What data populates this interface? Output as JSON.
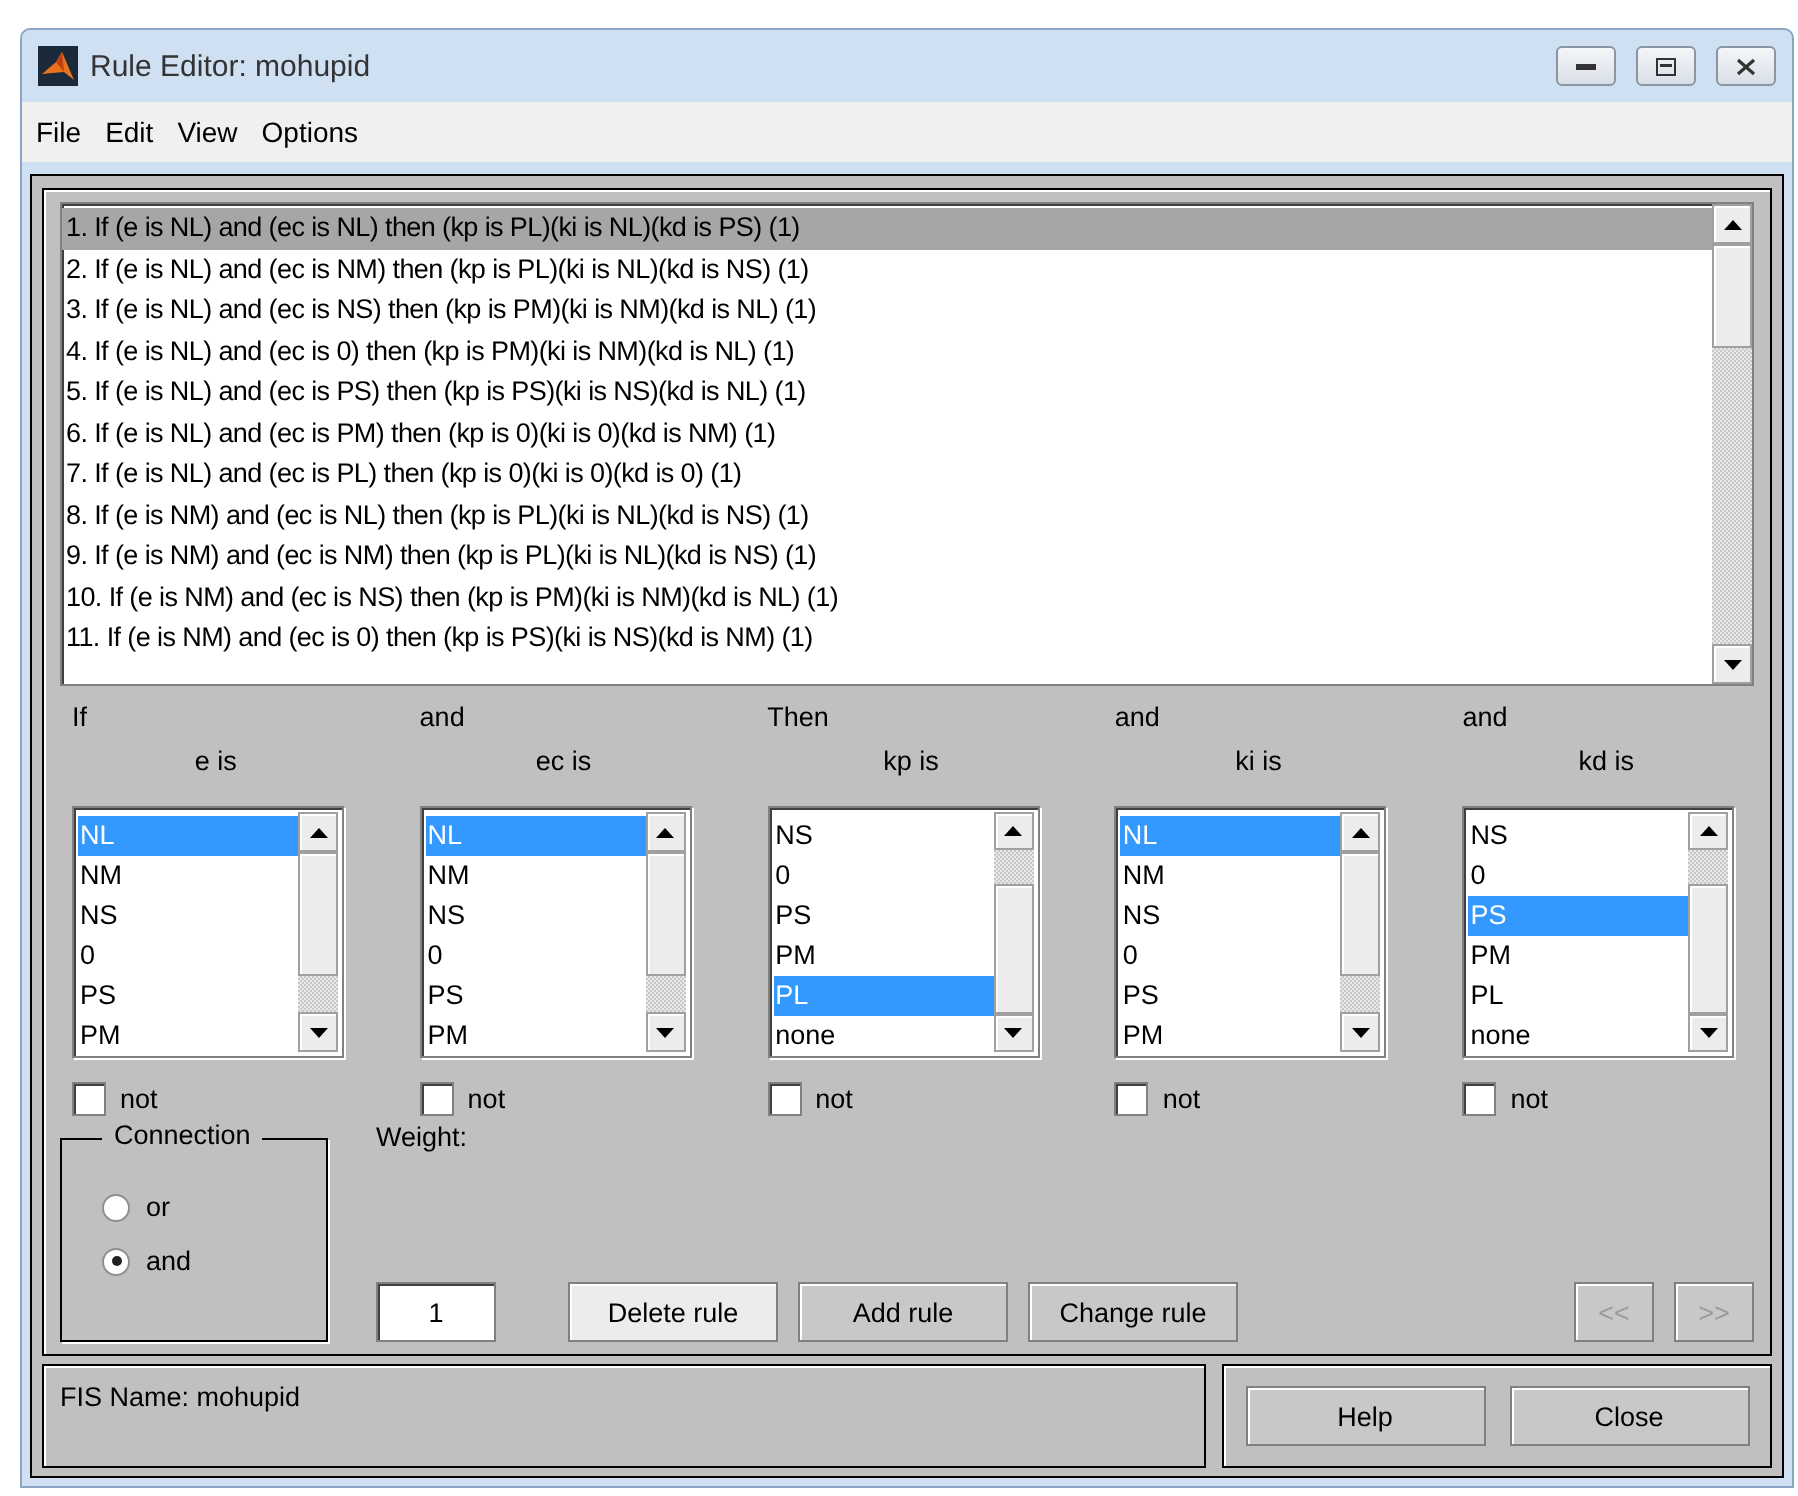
{
  "window": {
    "title": "Rule Editor: mohupid"
  },
  "menu": [
    "File",
    "Edit",
    "View",
    "Options"
  ],
  "rules": [
    {
      "text": "1. If (e is NL) and (ec is NL) then (kp is PL)(ki is NL)(kd is PS) (1)",
      "selected": true
    },
    {
      "text": "2. If (e is NL) and (ec is NM) then (kp is PL)(ki is NL)(kd is NS) (1)",
      "selected": false
    },
    {
      "text": "3. If (e is NL) and (ec is NS) then (kp is PM)(ki is NM)(kd is NL) (1)",
      "selected": false
    },
    {
      "text": "4. If (e is NL) and (ec is 0) then (kp is PM)(ki is NM)(kd is NL) (1)",
      "selected": false
    },
    {
      "text": "5. If (e is NL) and (ec is PS) then (kp is PS)(ki is NS)(kd is NL) (1)",
      "selected": false
    },
    {
      "text": "6. If (e is NL) and (ec is PM) then (kp is 0)(ki is 0)(kd is NM) (1)",
      "selected": false
    },
    {
      "text": "7. If (e is NL) and (ec is PL) then (kp is 0)(ki is 0)(kd is 0) (1)",
      "selected": false
    },
    {
      "text": "8. If (e is NM) and (ec is NL) then (kp is PL)(ki is NL)(kd is NS) (1)",
      "selected": false
    },
    {
      "text": "9. If (e is NM) and (ec is NM) then (kp is PL)(ki is NL)(kd is NS) (1)",
      "selected": false
    },
    {
      "text": "10. If (e is NM) and (ec is NS) then (kp is PM)(ki is NM)(kd is NL) (1)",
      "selected": false
    },
    {
      "text": "11. If (e is NM) and (ec is 0) then (kp is PS)(ki is NS)(kd is NM) (1)",
      "selected": false
    }
  ],
  "variables": [
    {
      "connector": "If",
      "label": "e is",
      "options": [
        {
          "text": "NL",
          "selected": true
        },
        {
          "text": "NM",
          "selected": false
        },
        {
          "text": "NS",
          "selected": false
        },
        {
          "text": "0",
          "selected": false
        },
        {
          "text": "PS",
          "selected": false
        },
        {
          "text": "PM",
          "selected": false
        }
      ],
      "not": {
        "label": "not",
        "checked": false
      }
    },
    {
      "connector": "and",
      "label": "ec is",
      "options": [
        {
          "text": "NL",
          "selected": true
        },
        {
          "text": "NM",
          "selected": false
        },
        {
          "text": "NS",
          "selected": false
        },
        {
          "text": "0",
          "selected": false
        },
        {
          "text": "PS",
          "selected": false
        },
        {
          "text": "PM",
          "selected": false
        }
      ],
      "not": {
        "label": "not",
        "checked": false
      }
    },
    {
      "connector": "Then",
      "label": "kp is",
      "options": [
        {
          "text": "NS",
          "selected": false
        },
        {
          "text": "0",
          "selected": false
        },
        {
          "text": "PS",
          "selected": false
        },
        {
          "text": "PM",
          "selected": false
        },
        {
          "text": "PL",
          "selected": true
        },
        {
          "text": "none",
          "selected": false
        }
      ],
      "not": {
        "label": "not",
        "checked": false
      }
    },
    {
      "connector": "and",
      "label": "ki is",
      "options": [
        {
          "text": "NL",
          "selected": true
        },
        {
          "text": "NM",
          "selected": false
        },
        {
          "text": "NS",
          "selected": false
        },
        {
          "text": "0",
          "selected": false
        },
        {
          "text": "PS",
          "selected": false
        },
        {
          "text": "PM",
          "selected": false
        }
      ],
      "not": {
        "label": "not",
        "checked": false
      }
    },
    {
      "connector": "and",
      "label": "kd is",
      "options": [
        {
          "text": "NS",
          "selected": false
        },
        {
          "text": "0",
          "selected": false
        },
        {
          "text": "PS",
          "selected": true
        },
        {
          "text": "PM",
          "selected": false
        },
        {
          "text": "PL",
          "selected": false
        },
        {
          "text": "none",
          "selected": false
        }
      ],
      "not": {
        "label": "not",
        "checked": false
      }
    }
  ],
  "connection": {
    "title": "Connection",
    "options": [
      {
        "label": "or",
        "selected": false
      },
      {
        "label": "and",
        "selected": true
      }
    ]
  },
  "weight": {
    "label": "Weight:",
    "value": "1"
  },
  "actions": [
    {
      "label": "Delete rule",
      "disabled": false
    },
    {
      "label": "Add rule",
      "disabled": false
    },
    {
      "label": "Change rule",
      "disabled": false
    }
  ],
  "navigation": [
    {
      "label": "<<",
      "disabled": true
    },
    {
      "label": ">>",
      "disabled": true
    }
  ],
  "status_bar": {
    "text": "FIS Name: mohupid"
  },
  "footer_buttons": [
    {
      "label": "Help"
    },
    {
      "label": "Close"
    }
  ]
}
